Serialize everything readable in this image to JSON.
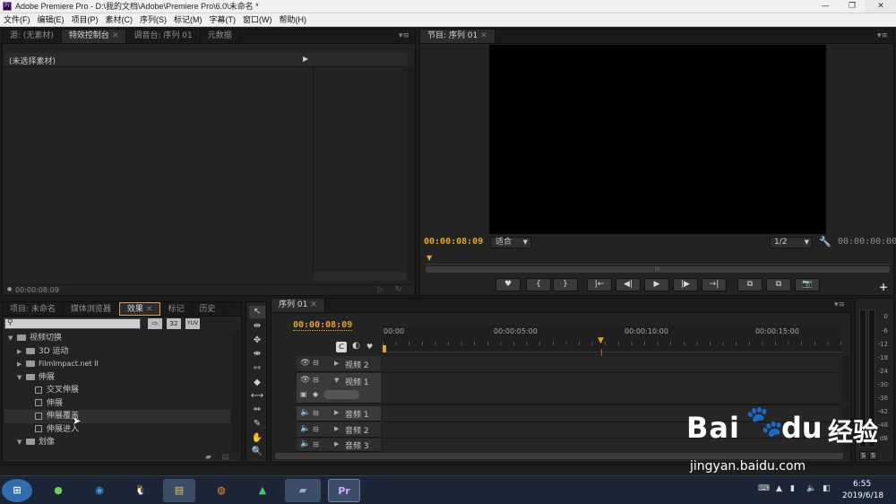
{
  "window": {
    "logo": "Pr",
    "title": "Adobe Premiere Pro - D:\\我的文档\\Adobe\\Premiere Pro\\6.0\\未命名 *",
    "minimize": "—",
    "maximize": "❐",
    "close": "✕"
  },
  "menu": [
    "文件(F)",
    "编辑(E)",
    "项目(P)",
    "素材(C)",
    "序列(S)",
    "标记(M)",
    "字幕(T)",
    "窗口(W)",
    "帮助(H)"
  ],
  "source_panel": {
    "tabs": [
      "源: (无素材)",
      "特效控制台",
      "调音台: 序列 01",
      "元数据"
    ],
    "active_tab": 1,
    "header_text": "(未选择素材)",
    "footer_timecode": "00:00:08:09"
  },
  "program_panel": {
    "tab": "节目: 序列 01",
    "timecode": "00:00:08:09",
    "fit_label": "适合",
    "quality_label": "1/2",
    "duration_timecode": "00:00:00:00",
    "buttons": [
      "♥",
      "{",
      "}",
      "|←",
      "◀|",
      "▶",
      "|▶",
      "→|",
      "⧉",
      "⧉",
      "📷"
    ]
  },
  "effects_panel": {
    "tabs": [
      "项目: 未命名",
      "媒体浏览器",
      "效果",
      "标记",
      "历史"
    ],
    "active_tab": 2,
    "search_placeholder": "",
    "filter_buttons": [
      "⇨",
      "32",
      "YUV"
    ],
    "tree": [
      {
        "label": "视频切换",
        "type": "folder",
        "level": 0,
        "expanded": true
      },
      {
        "label": "3D 运动",
        "type": "folder",
        "level": 1,
        "expanded": false
      },
      {
        "label": "FilmImpact.net II",
        "type": "folder",
        "level": 1,
        "expanded": false
      },
      {
        "label": "伸展",
        "type": "folder",
        "level": 1,
        "expanded": true
      },
      {
        "label": "交叉伸展",
        "type": "effect",
        "level": 2
      },
      {
        "label": "伸展",
        "type": "effect",
        "level": 2
      },
      {
        "label": "伸展覆盖",
        "type": "effect",
        "level": 2,
        "hover": true
      },
      {
        "label": "伸展进入",
        "type": "effect",
        "level": 2
      },
      {
        "label": "划像",
        "type": "folder",
        "level": 1,
        "expanded": true
      }
    ]
  },
  "tools": [
    "↖",
    "⇹",
    "✥",
    "⇼",
    "⇿",
    "◆",
    "⟷",
    "⇔",
    "✎",
    "✋",
    "🔍"
  ],
  "timeline": {
    "tab": "序列 01",
    "timecode": "00:00:08:09",
    "ruler_labels": [
      "00:00",
      "00:00:05:00",
      "00:00:10:00",
      "00:00:15:00"
    ],
    "playhead_fraction": 0.485,
    "tracks": [
      {
        "name": "视频 2",
        "kind": "video",
        "expanded": false
      },
      {
        "name": "视频 1",
        "kind": "video",
        "expanded": true
      },
      {
        "name": "音频 1",
        "kind": "audio",
        "expanded": false
      },
      {
        "name": "音频 2",
        "kind": "audio",
        "expanded": false
      },
      {
        "name": "音频 3",
        "kind": "audio",
        "expanded": false
      }
    ]
  },
  "audio_meter": {
    "labels": [
      "0",
      "-6",
      "-12",
      "-18",
      "-24",
      "-30",
      "-36",
      "-42",
      "-48",
      "dB"
    ],
    "solo_buttons": [
      "S",
      "S"
    ]
  },
  "watermark": {
    "brand": "Bai",
    "brand2": "du",
    "suffix": "经验",
    "url": "jingyan.baidu.com"
  },
  "taskbar": {
    "apps": [
      "⊞",
      "●",
      "◉",
      "🐧",
      "▤",
      "◍",
      "▲",
      "▰",
      "Pr"
    ],
    "clock_time": "6:55",
    "clock_date": "2019/6/18"
  },
  "colors": {
    "accent": "#e8a32a",
    "playhead": "#c8501c",
    "panel_bg": "#232323"
  }
}
